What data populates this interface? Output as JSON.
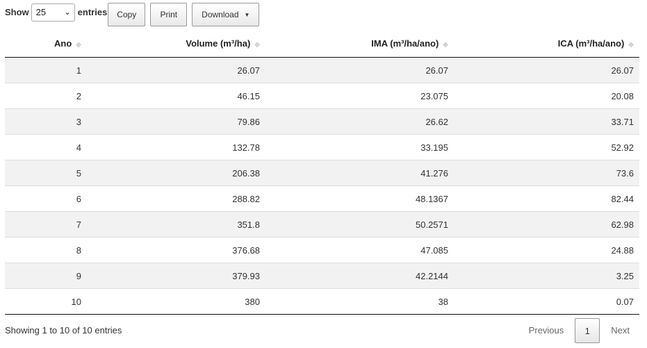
{
  "controls": {
    "show_label": "Show",
    "page_size": "25",
    "entries_label": "entries",
    "copy_label": "Copy",
    "print_label": "Print",
    "download_label": "Download"
  },
  "table": {
    "columns": [
      "Ano",
      "Volume (m³/ha)",
      "IMA (m³/ha/ano)",
      "ICA (m³/ha/ano)"
    ],
    "rows": [
      [
        "1",
        "26.07",
        "26.07",
        "26.07"
      ],
      [
        "2",
        "46.15",
        "23.075",
        "20.08"
      ],
      [
        "3",
        "79.86",
        "26.62",
        "33.71"
      ],
      [
        "4",
        "132.78",
        "33.195",
        "52.92"
      ],
      [
        "5",
        "206.38",
        "41.276",
        "73.6"
      ],
      [
        "6",
        "288.82",
        "48.1367",
        "82.44"
      ],
      [
        "7",
        "351.8",
        "50.2571",
        "62.98"
      ],
      [
        "8",
        "376.68",
        "47.085",
        "24.88"
      ],
      [
        "9",
        "379.93",
        "42.2144",
        "3.25"
      ],
      [
        "10",
        "380",
        "38",
        "0.07"
      ]
    ]
  },
  "footer": {
    "info": "Showing 1 to 10 of 10 entries",
    "previous_label": "Previous",
    "current_page": "1",
    "next_label": "Next"
  },
  "icons": {
    "sort": "sort-both-icon",
    "dropdown": "chevron-down-icon",
    "caret": "caret-down-icon"
  }
}
